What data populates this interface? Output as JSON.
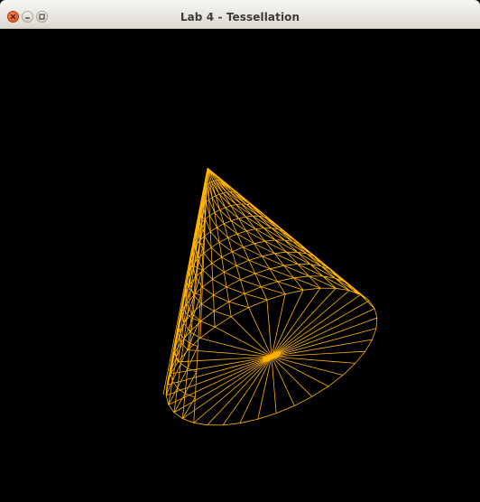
{
  "window": {
    "title": "Lab 4 - Tessellation",
    "buttons": [
      "close",
      "minimize",
      "maximize"
    ]
  },
  "scene": {
    "background": "#000000",
    "wire_color": "#ffb300",
    "primitive": "cone",
    "render_mode": "wireframe"
  },
  "colors": {
    "close": "#e25a24",
    "titlebar": "#ebe9e3",
    "title_text": "#3d3c38"
  }
}
